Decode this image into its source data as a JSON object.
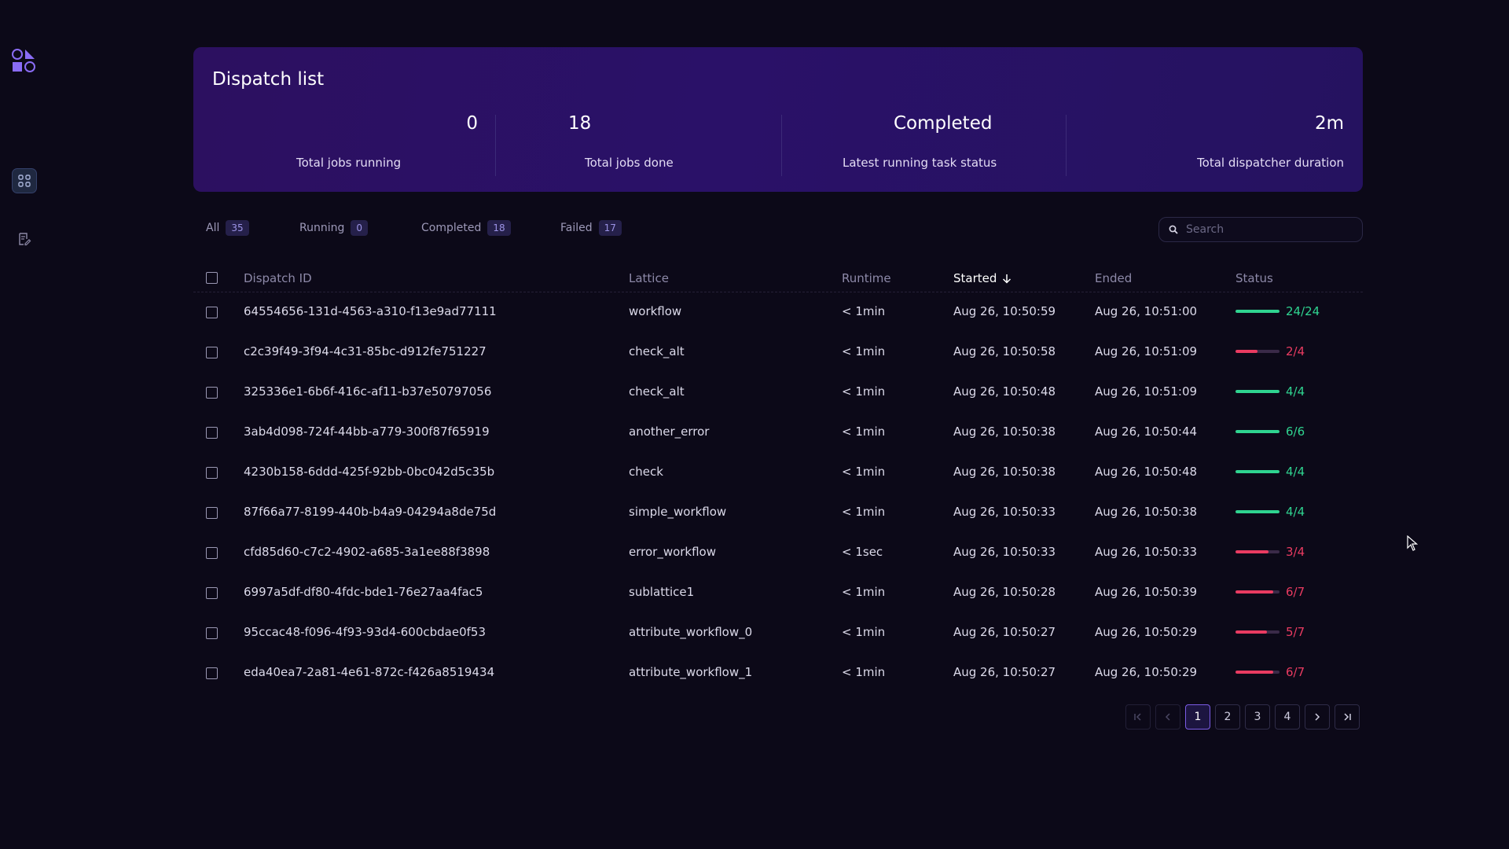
{
  "summary": {
    "title": "Dispatch list",
    "stats": [
      {
        "value": "0",
        "label": "Total jobs running"
      },
      {
        "value": "18",
        "label": "Total jobs done"
      },
      {
        "value": "Completed",
        "label": "Latest running task status"
      },
      {
        "value": "2m",
        "label": "Total dispatcher duration"
      }
    ]
  },
  "filters": [
    {
      "label": "All",
      "count": "35"
    },
    {
      "label": "Running",
      "count": "0"
    },
    {
      "label": "Completed",
      "count": "18"
    },
    {
      "label": "Failed",
      "count": "17"
    }
  ],
  "search": {
    "placeholder": "Search",
    "value": ""
  },
  "table": {
    "headers": {
      "dispatch_id": "Dispatch ID",
      "lattice": "Lattice",
      "runtime": "Runtime",
      "started": "Started",
      "ended": "Ended",
      "status": "Status"
    },
    "sort": {
      "column": "Started",
      "direction": "descending"
    },
    "rows": [
      {
        "id": "64554656-131d-4563-a310-f13e9ad77111",
        "lattice": "workflow",
        "runtime": "< 1min",
        "started": "Aug 26, 10:50:59",
        "ended": "Aug 26, 10:51:00",
        "status": "24/24",
        "progress": 1.0,
        "state": "completed"
      },
      {
        "id": "c2c39f49-3f94-4c31-85bc-d912fe751227",
        "lattice": "check_alt",
        "runtime": "< 1min",
        "started": "Aug 26, 10:50:58",
        "ended": "Aug 26, 10:51:09",
        "status": "2/4",
        "progress": 0.5,
        "state": "failed"
      },
      {
        "id": "325336e1-6b6f-416c-af11-b37e50797056",
        "lattice": "check_alt",
        "runtime": "< 1min",
        "started": "Aug 26, 10:50:48",
        "ended": "Aug 26, 10:51:09",
        "status": "4/4",
        "progress": 1.0,
        "state": "completed"
      },
      {
        "id": "3ab4d098-724f-44bb-a779-300f87f65919",
        "lattice": "another_error",
        "runtime": "< 1min",
        "started": "Aug 26, 10:50:38",
        "ended": "Aug 26, 10:50:44",
        "status": "6/6",
        "progress": 1.0,
        "state": "completed"
      },
      {
        "id": "4230b158-6ddd-425f-92bb-0bc042d5c35b",
        "lattice": "check",
        "runtime": "< 1min",
        "started": "Aug 26, 10:50:38",
        "ended": "Aug 26, 10:50:48",
        "status": "4/4",
        "progress": 1.0,
        "state": "completed"
      },
      {
        "id": "87f66a77-8199-440b-b4a9-04294a8de75d",
        "lattice": "simple_workflow",
        "runtime": "< 1min",
        "started": "Aug 26, 10:50:33",
        "ended": "Aug 26, 10:50:38",
        "status": "4/4",
        "progress": 1.0,
        "state": "completed"
      },
      {
        "id": "cfd85d60-c7c2-4902-a685-3a1ee88f3898",
        "lattice": "error_workflow",
        "runtime": "< 1sec",
        "started": "Aug 26, 10:50:33",
        "ended": "Aug 26, 10:50:33",
        "status": "3/4",
        "progress": 0.75,
        "state": "failed"
      },
      {
        "id": "6997a5df-df80-4fdc-bde1-76e27aa4fac5",
        "lattice": "sublattice1",
        "runtime": "< 1min",
        "started": "Aug 26, 10:50:28",
        "ended": "Aug 26, 10:50:39",
        "status": "6/7",
        "progress": 0.857,
        "state": "failed"
      },
      {
        "id": "95ccac48-f096-4f93-93d4-600cbdae0f53",
        "lattice": "attribute_workflow_0",
        "runtime": "< 1min",
        "started": "Aug 26, 10:50:27",
        "ended": "Aug 26, 10:50:29",
        "status": "5/7",
        "progress": 0.714,
        "state": "failed"
      },
      {
        "id": "eda40ea7-2a81-4e61-872c-f426a8519434",
        "lattice": "attribute_workflow_1",
        "runtime": "< 1min",
        "started": "Aug 26, 10:50:27",
        "ended": "Aug 26, 10:50:29",
        "status": "6/7",
        "progress": 0.857,
        "state": "failed"
      }
    ]
  },
  "pagination": {
    "pages": [
      "1",
      "2",
      "3",
      "4"
    ],
    "current": "1"
  },
  "colors": {
    "completed": "#2fd490",
    "failed": "#ea3b61",
    "accent": "#7b5ce6"
  },
  "icons": [
    "covalent-logo-icon",
    "dispatch-list-icon",
    "logs-icon",
    "search-icon",
    "arrow-down-icon",
    "first-page-icon",
    "prev-page-icon",
    "next-page-icon",
    "last-page-icon",
    "mouse-cursor-icon"
  ]
}
